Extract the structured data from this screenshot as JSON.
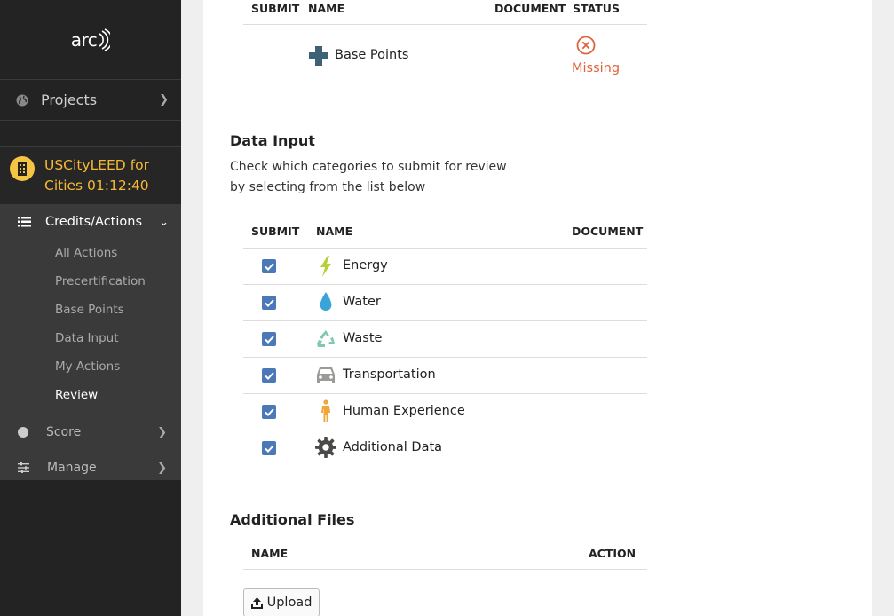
{
  "sidebar": {
    "logo": "arc",
    "projects_label": "Projects",
    "project_name_line1": "USCityLEED for",
    "project_name_line2": "Cities 01:12:40",
    "credits_label": "Credits/Actions",
    "sub_items": [
      "All Actions",
      "Precertification",
      "Base Points",
      "Data Input",
      "My Actions",
      "Review"
    ],
    "score_label": "Score",
    "manage_label": "Manage"
  },
  "base_table": {
    "headers": {
      "submit": "SUBMIT",
      "name": "NAME",
      "document": "DOCUMENT",
      "status": "STATUS"
    },
    "row": {
      "name": "Base Points",
      "status": "Missing"
    }
  },
  "data_input": {
    "title": "Data Input",
    "description": "Check which categories to submit for review by selecting from the list below",
    "headers": {
      "submit": "SUBMIT",
      "name": "NAME",
      "document": "DOCUMENT"
    },
    "rows": [
      {
        "name": "Energy",
        "icon": "energy-icon",
        "checked": true
      },
      {
        "name": "Water",
        "icon": "water-icon",
        "checked": true
      },
      {
        "name": "Waste",
        "icon": "waste-icon",
        "checked": true
      },
      {
        "name": "Transportation",
        "icon": "transportation-icon",
        "checked": true
      },
      {
        "name": "Human Experience",
        "icon": "human-experience-icon",
        "checked": true
      },
      {
        "name": "Additional Data",
        "icon": "gear-icon",
        "checked": true
      }
    ]
  },
  "additional_files": {
    "title": "Additional Files",
    "headers": {
      "name": "NAME",
      "action": "ACTION"
    },
    "upload_label": "Upload"
  },
  "colors": {
    "sidebar_bg": "#232323",
    "sidebar_group_bg": "#3a3a3a",
    "project_accent": "#f6b935",
    "missing": "#e0623b",
    "checkbox": "#4b78b6"
  }
}
